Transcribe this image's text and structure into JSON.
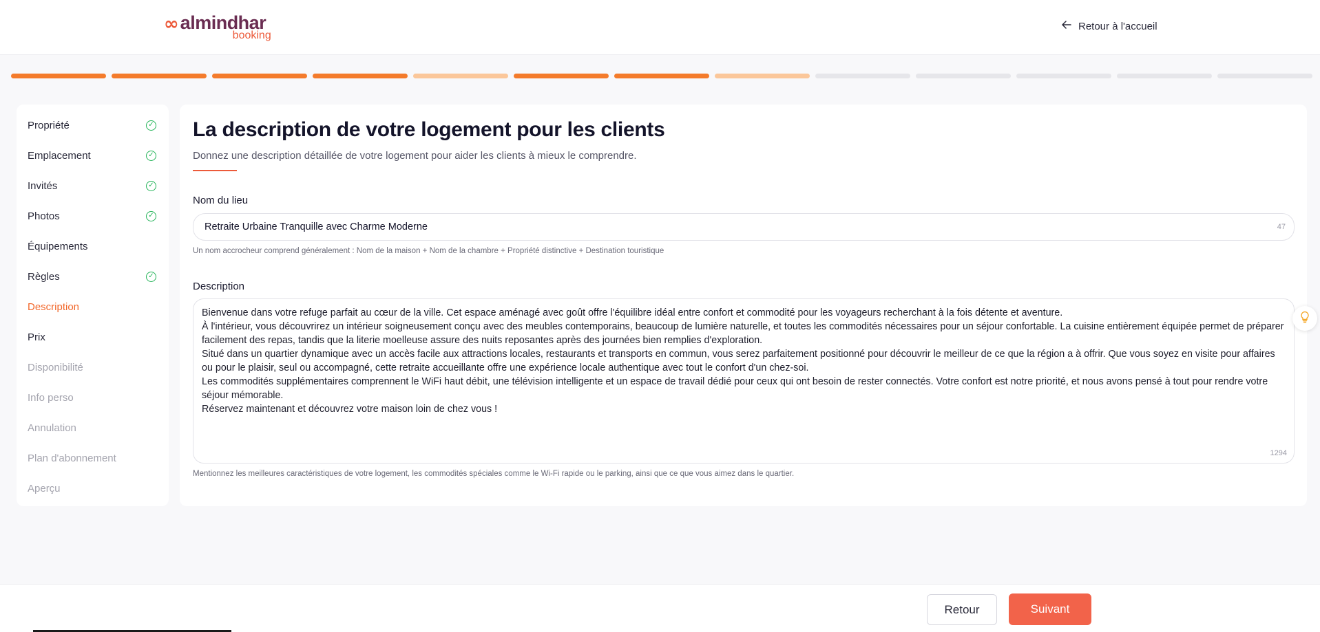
{
  "header": {
    "logo_main": "almindhar",
    "logo_sub": "booking",
    "back_home": "Retour à l'accueil"
  },
  "progress": {
    "steps": [
      "done",
      "done",
      "done",
      "done",
      "partial",
      "done",
      "done",
      "partial",
      "todo",
      "todo",
      "todo",
      "todo",
      "todo"
    ]
  },
  "sidebar": {
    "items": [
      {
        "label": "Propriété",
        "state": "completed"
      },
      {
        "label": "Emplacement",
        "state": "completed"
      },
      {
        "label": "Invités",
        "state": "completed"
      },
      {
        "label": "Photos",
        "state": "completed"
      },
      {
        "label": "Équipements",
        "state": "plain"
      },
      {
        "label": "Règles",
        "state": "completed"
      },
      {
        "label": "Description",
        "state": "active"
      },
      {
        "label": "Prix",
        "state": "plain"
      },
      {
        "label": "Disponibilité",
        "state": "disabled"
      },
      {
        "label": "Info perso",
        "state": "disabled"
      },
      {
        "label": "Annulation",
        "state": "disabled"
      },
      {
        "label": "Plan d'abonnement",
        "state": "disabled"
      },
      {
        "label": "Aperçu",
        "state": "disabled"
      }
    ]
  },
  "main": {
    "title": "La description de votre logement pour les clients",
    "subtitle": "Donnez une description détaillée de votre logement pour aider les clients à mieux le comprendre.",
    "name_label": "Nom du lieu",
    "name_value": "Retraite Urbaine Tranquille avec Charme Moderne",
    "name_counter": "47",
    "name_hint": "Un nom accrocheur comprend généralement : Nom de la maison + Nom de la chambre + Propriété distinctive + Destination touristique",
    "description_label": "Description",
    "description_value": "Bienvenue dans votre refuge parfait au cœur de la ville. Cet espace aménagé avec goût offre l'équilibre idéal entre confort et commodité pour les voyageurs recherchant à la fois détente et aventure.\nÀ l'intérieur, vous découvrirez un intérieur soigneusement conçu avec des meubles contemporains, beaucoup de lumière naturelle, et toutes les commodités nécessaires pour un séjour confortable. La cuisine entièrement équipée permet de préparer facilement des repas, tandis que la literie moelleuse assure des nuits reposantes après des journées bien remplies d'exploration.\nSitué dans un quartier dynamique avec un accès facile aux attractions locales, restaurants et transports en commun, vous serez parfaitement positionné pour découvrir le meilleur de ce que la région a à offrir. Que vous soyez en visite pour affaires ou pour le plaisir, seul ou accompagné, cette retraite accueillante offre une expérience locale authentique avec tout le confort d'un chez-soi.\nLes commodités supplémentaires comprennent le WiFi haut débit, une télévision intelligente et un espace de travail dédié pour ceux qui ont besoin de rester connectés. Votre confort est notre priorité, et nous avons pensé à tout pour rendre votre séjour mémorable.\nRéservez maintenant et découvrez votre maison loin de chez vous !",
    "description_counter": "1294",
    "description_hint": "Mentionnez les meilleures caractéristiques de votre logement, les commodités spéciales comme le Wi-Fi rapide ou le parking, ainsi que ce que vous aimez dans le quartier."
  },
  "footer": {
    "back_label": "Retour",
    "next_label": "Suivant"
  },
  "colors": {
    "accent": "#f2634a",
    "progress_done": "#f47b2b",
    "progress_partial": "#fbc79a",
    "progress_todo": "#e6e6ea",
    "success": "#22b357"
  },
  "icons": {
    "back_home": "arrow-left-icon",
    "completed": "check-circle-icon",
    "tip": "lightbulb-icon",
    "logo": "infinity-logo-icon"
  }
}
